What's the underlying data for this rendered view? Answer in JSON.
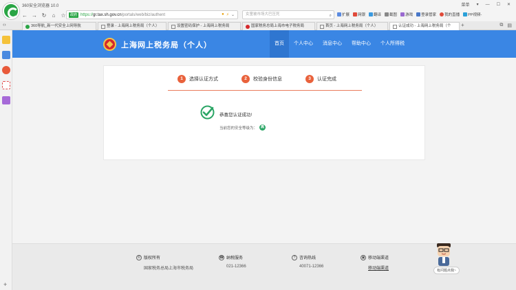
{
  "browser": {
    "title": "360安全浏览器 10.0",
    "window_controls": [
      "菜单",
      "▾",
      "—",
      "☐",
      "✕"
    ],
    "url": {
      "safe_badge": "政府",
      "scheme": "https://",
      "host": "gr.tax.sh.gov.cn",
      "path": "/portals/web/biz/authent"
    },
    "search_placeholder": "女童被市场大巴压死",
    "toolbar": [
      "扩展",
      "网银",
      "翻译",
      "截图",
      "游戏",
      "登录管家",
      "我的直播",
      "PP视频-"
    ],
    "tabs": [
      {
        "label": "360导航_新一代安全上网导航",
        "active": false
      },
      {
        "label": "登录 - 上海网上税务局（个人）",
        "active": false
      },
      {
        "label": "设置密码保护 - 上海网上税务局",
        "active": false
      },
      {
        "label": "国家税务总局上海市电子税务局",
        "active": false
      },
      {
        "label": "首页 - 上海网上税务局（个人）",
        "active": false
      },
      {
        "label": "认证成功 - 上海网上税务局（个",
        "active": true
      }
    ]
  },
  "site": {
    "title": "上海网上税务局（个人）",
    "nav": [
      "首页",
      "个人中心",
      "消息中心",
      "帮助中心",
      "个人所得税"
    ],
    "active_nav": "首页"
  },
  "steps": [
    {
      "num": "1",
      "label": "选择认证方式"
    },
    {
      "num": "2",
      "label": "校验身份信息"
    },
    {
      "num": "3",
      "label": "认证完成"
    }
  ],
  "result": {
    "message": "恭喜您认证成功!",
    "level_label": "当前您的安全等级为：",
    "level_value": "高"
  },
  "footer": [
    {
      "icon": "©",
      "title": "版权所有",
      "value": "国家税务总局上海市税务局"
    },
    {
      "icon": "☎",
      "title": "纳税服务",
      "value": "021-12366"
    },
    {
      "icon": "?",
      "title": "咨询热线",
      "value": "40071-12366"
    },
    {
      "icon": "▣",
      "title": "移动端渠道",
      "value": "移动端渠道"
    }
  ],
  "assistant_label": "有问题点我~",
  "colors": {
    "header_blue": "#3a86e4",
    "step_orange": "#e9623c",
    "success_green": "#2aa565"
  }
}
